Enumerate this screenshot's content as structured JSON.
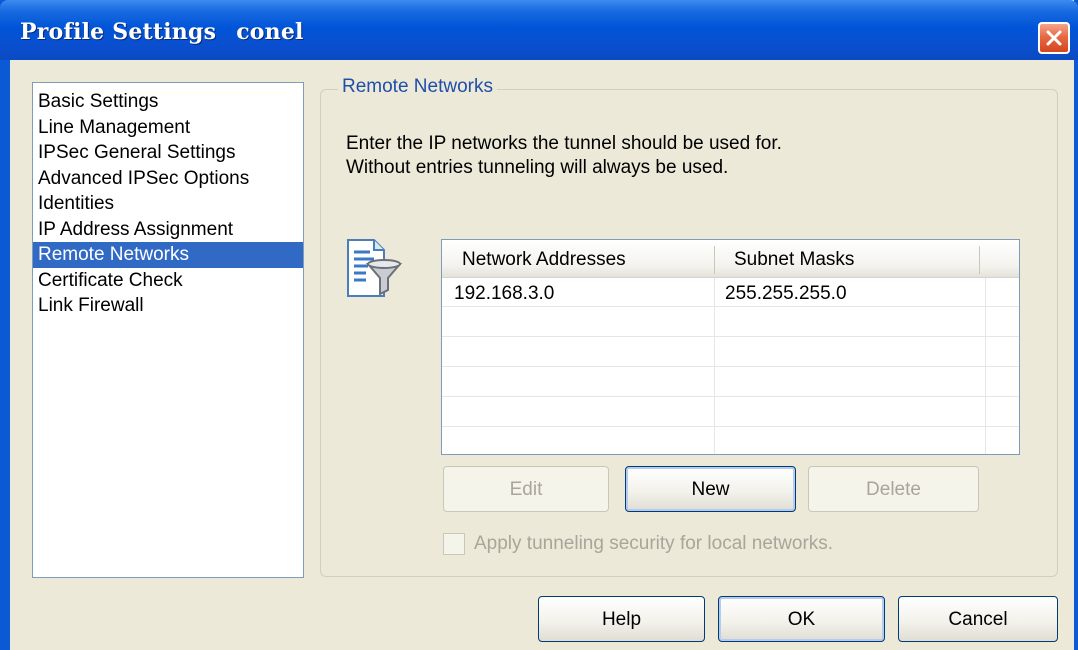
{
  "window": {
    "title": "Profile Settings",
    "title_profile": "conel",
    "title_color": "#0055d8",
    "close_icon": "close-icon"
  },
  "nav": {
    "items": [
      {
        "label": "Basic Settings",
        "selected": false
      },
      {
        "label": "Line Management",
        "selected": false
      },
      {
        "label": "IPSec General Settings",
        "selected": false
      },
      {
        "label": "Advanced IPSec Options",
        "selected": false
      },
      {
        "label": "Identities",
        "selected": false
      },
      {
        "label": "IP Address Assignment",
        "selected": false
      },
      {
        "label": "Remote Networks",
        "selected": true
      },
      {
        "label": "Certificate Check",
        "selected": false
      },
      {
        "label": "Link Firewall",
        "selected": false
      }
    ],
    "selection_color": "#316ac5"
  },
  "panel": {
    "group_label": "Remote Networks",
    "intro_line1": "Enter the IP networks the tunnel should be used for.",
    "intro_line2": "Without entries tunneling will always be used.",
    "icon": "filter-icon"
  },
  "table": {
    "columns": [
      "Network Addresses",
      "Subnet Masks"
    ],
    "rows": [
      {
        "address": "192.168.3.0",
        "mask": "255.255.255.0"
      }
    ]
  },
  "row_buttons": {
    "edit": {
      "label": "Edit",
      "enabled": false
    },
    "new": {
      "label": "New",
      "enabled": true
    },
    "delete": {
      "label": "Delete",
      "enabled": false
    }
  },
  "option": {
    "label": "Apply tunneling security for local networks.",
    "checked": false,
    "enabled": false
  },
  "footer": {
    "help": "Help",
    "ok": "OK",
    "cancel": "Cancel"
  }
}
